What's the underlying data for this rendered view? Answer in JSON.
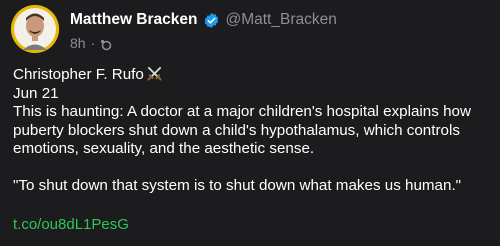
{
  "author": {
    "display_name": "Matthew Bracken",
    "handle": "@Matt_Bracken",
    "time": "8h",
    "separator": "·"
  },
  "colors": {
    "background": "#1c1c1e",
    "text": "#ffffff",
    "muted": "#8e8e93",
    "verified": "#1d9bf0",
    "link": "#2fc659",
    "avatar_bg": "#e6b800"
  },
  "quote": {
    "author_name": "Christopher F. Rufo",
    "author_emoji": "crossed-swords-icon",
    "date": "Jun 21",
    "lines": [
      "This is haunting: A doctor at a major children's hospital explains how",
      "puberty blockers shut down a child's hypothalamus, which controls",
      "emotions, sexuality, and the aesthetic sense."
    ],
    "quote_line": "\"To shut down that system is to shut down what makes us human.\""
  },
  "link": {
    "text": "t.co/ou8dL1PesG"
  }
}
